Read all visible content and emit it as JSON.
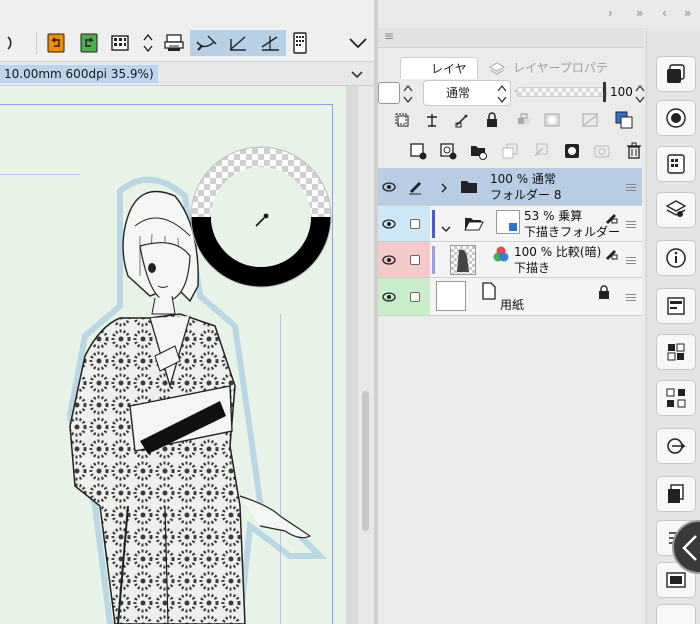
{
  "document": {
    "title": "10.00mm 600dpi 35.9%)"
  },
  "toolbar": {
    "items": [
      "rotate-handle-icon",
      "undo-icon",
      "redo-icon",
      "grid-icon",
      "stepper-icon",
      "print-icon",
      "ruler-snap-icon",
      "special-ruler-snap-icon",
      "grid-snap-icon",
      "device-icon",
      "menu-chevron-icon"
    ]
  },
  "layer_panel": {
    "tabs": [
      {
        "label": "レイヤー",
        "active": true
      },
      {
        "label": "レイヤープロパティ",
        "active": false
      }
    ],
    "blend_mode": "通常",
    "opacity": "100",
    "layers": [
      {
        "percent_mode": "100 % 通常",
        "name": "フォルダー 8",
        "selected": true,
        "type": "folder",
        "eye_color": "#b8cde3"
      },
      {
        "percent_mode": "53 % 乗算",
        "name": "下描きフォルダー",
        "selected": false,
        "type": "folder-open",
        "eye_color": "#cfe8f5"
      },
      {
        "percent_mode": "100 % 比較(暗)",
        "name": "下描き",
        "selected": false,
        "type": "raster",
        "eye_color": "#f5c9c9"
      },
      {
        "percent_mode": "",
        "name": "用紙",
        "selected": false,
        "type": "paper",
        "eye_color": "#c9ecc9"
      }
    ]
  },
  "dock": {
    "buttons": [
      "navigator-icon",
      "sub-view-icon",
      "layer-properties-icon",
      "layer-search-icon",
      "info-icon",
      "item-bank-icon",
      "material-icon",
      "auto-action-icon",
      "connect-icon",
      "layer-icon",
      "timeline-icon",
      "animation-icon"
    ]
  },
  "colors": {
    "selection": "#b8cde3",
    "canvas": "#e6f3e6",
    "guide": "#8f9fe6"
  }
}
